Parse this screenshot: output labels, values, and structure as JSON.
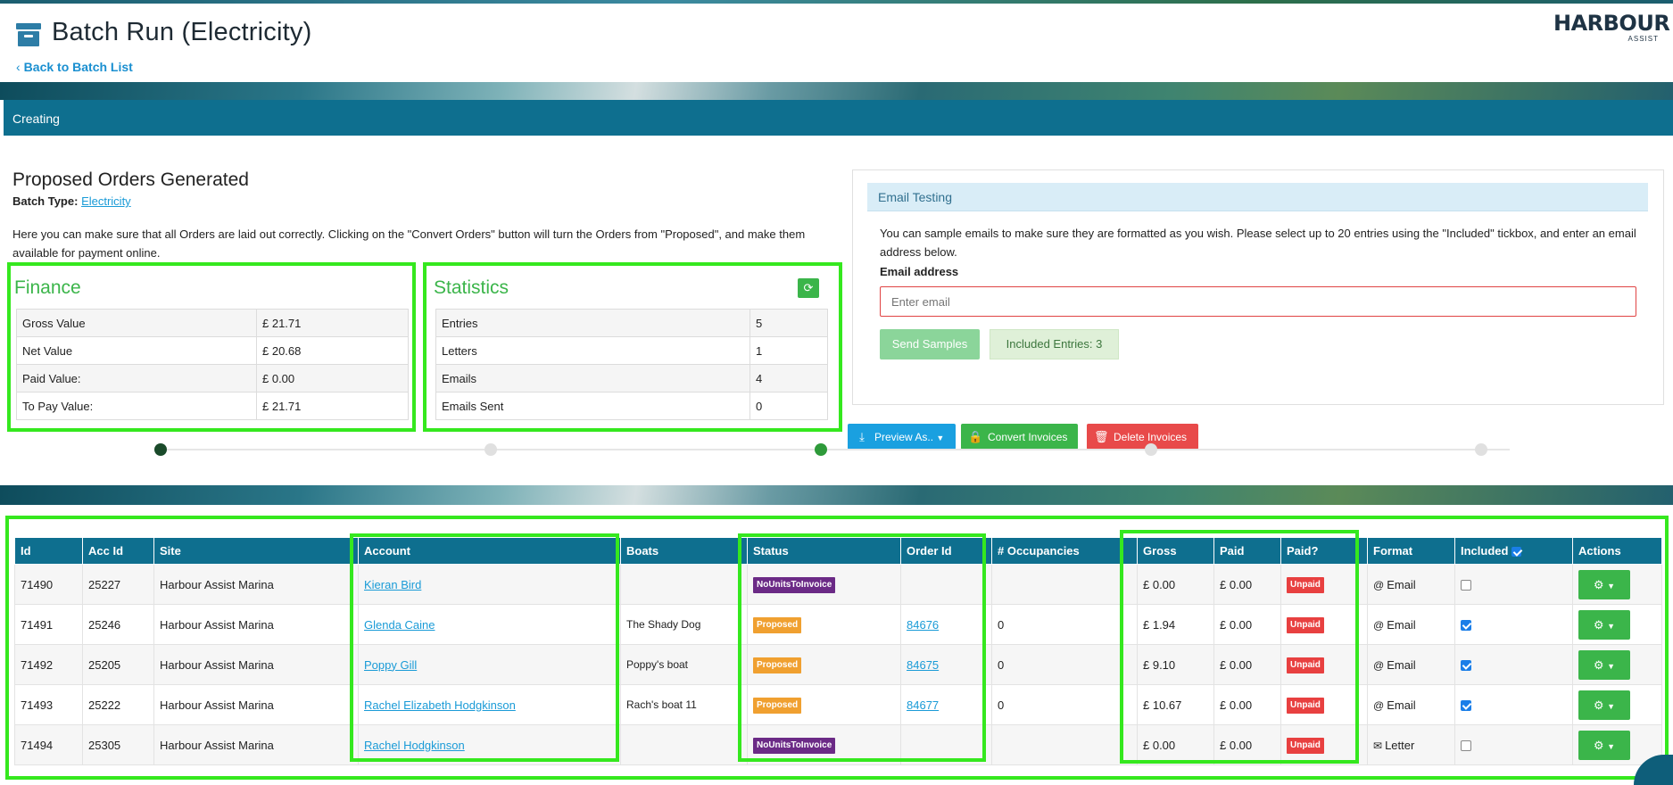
{
  "header": {
    "title": "Batch Run (Electricity)",
    "back_link": "Back to Batch List",
    "logo_main": "HARBOUR",
    "logo_sub": "ASSIST"
  },
  "status_bar": {
    "label": "Creating"
  },
  "summary": {
    "title": "Proposed Orders Generated",
    "batch_type_label": "Batch Type:",
    "batch_type_value": "Electricity",
    "intro": "Here you can make sure that all Orders are laid out correctly. Clicking on the \"Convert Orders\" button will turn the Orders from \"Proposed\", and make them available for payment online."
  },
  "finance": {
    "title": "Finance",
    "rows": [
      {
        "label": "Gross Value",
        "value": "£ 21.71"
      },
      {
        "label": "Net Value",
        "value": "£ 20.68"
      },
      {
        "label": "Paid Value:",
        "value": "£ 0.00"
      },
      {
        "label": "To Pay Value:",
        "value": "£ 21.71"
      }
    ]
  },
  "statistics": {
    "title": "Statistics",
    "refresh_icon": "refresh-icon",
    "rows": [
      {
        "label": "Entries",
        "value": "5"
      },
      {
        "label": "Letters",
        "value": "1"
      },
      {
        "label": "Emails",
        "value": "4"
      },
      {
        "label": "Emails Sent",
        "value": "0"
      }
    ]
  },
  "email_testing": {
    "heading": "Email Testing",
    "description": "You can sample emails to make sure they are formatted as you wish. Please select up to 20 entries using the \"Included\" tickbox, and enter an email address below.",
    "label": "Email address",
    "placeholder": "Enter email",
    "send_label": "Send Samples",
    "included_label": "Included Entries: 3"
  },
  "actions": {
    "preview": "Preview As..",
    "convert": "Convert Invoices",
    "delete": "Delete Invoices"
  },
  "progress": {
    "steps": 5,
    "completed": 1,
    "active_step": 3
  },
  "table": {
    "headers": [
      "Id",
      "Acc Id",
      "Site",
      "Account",
      "Boats",
      "Status",
      "Order Id",
      "# Occupancies",
      "Gross",
      "Paid",
      "Paid?",
      "Format",
      "Included",
      "Actions"
    ],
    "rows": [
      {
        "id": "71490",
        "acc_id": "25227",
        "site": "Harbour Assist Marina",
        "account": "Kieran Bird",
        "boats": "",
        "status": "NoUnitsToInvoice",
        "order_id": "",
        "occupancies": "",
        "gross": "£ 0.00",
        "paid": "£ 0.00",
        "paid_status": "Unpaid",
        "format": "Email",
        "included": false
      },
      {
        "id": "71491",
        "acc_id": "25246",
        "site": "Harbour Assist Marina",
        "account": "Glenda Caine",
        "boats": "The Shady Dog",
        "status": "Proposed",
        "order_id": "84676",
        "occupancies": "0",
        "gross": "£ 1.94",
        "paid": "£ 0.00",
        "paid_status": "Unpaid",
        "format": "Email",
        "included": true
      },
      {
        "id": "71492",
        "acc_id": "25205",
        "site": "Harbour Assist Marina",
        "account": "Poppy Gill",
        "boats": "Poppy's boat",
        "status": "Proposed",
        "order_id": "84675",
        "occupancies": "0",
        "gross": "£ 9.10",
        "paid": "£ 0.00",
        "paid_status": "Unpaid",
        "format": "Email",
        "included": true
      },
      {
        "id": "71493",
        "acc_id": "25222",
        "site": "Harbour Assist Marina",
        "account": "Rachel Elizabeth Hodgkinson",
        "boats": "Rach's boat 11",
        "status": "Proposed",
        "order_id": "84677",
        "occupancies": "0",
        "gross": "£ 10.67",
        "paid": "£ 0.00",
        "paid_status": "Unpaid",
        "format": "Email",
        "included": true
      },
      {
        "id": "71494",
        "acc_id": "25305",
        "site": "Harbour Assist Marina",
        "account": "Rachel Hodgkinson",
        "boats": "",
        "status": "NoUnitsToInvoice",
        "order_id": "",
        "occupancies": "",
        "gross": "£ 0.00",
        "paid": "£ 0.00",
        "paid_status": "Unpaid",
        "format": "Letter",
        "included": false
      }
    ]
  },
  "colors": {
    "primary": "#0e6f8f",
    "success": "#3bb54a",
    "danger": "#e84a4a",
    "info": "#1aa0e0",
    "highlight": "#35e81e"
  }
}
